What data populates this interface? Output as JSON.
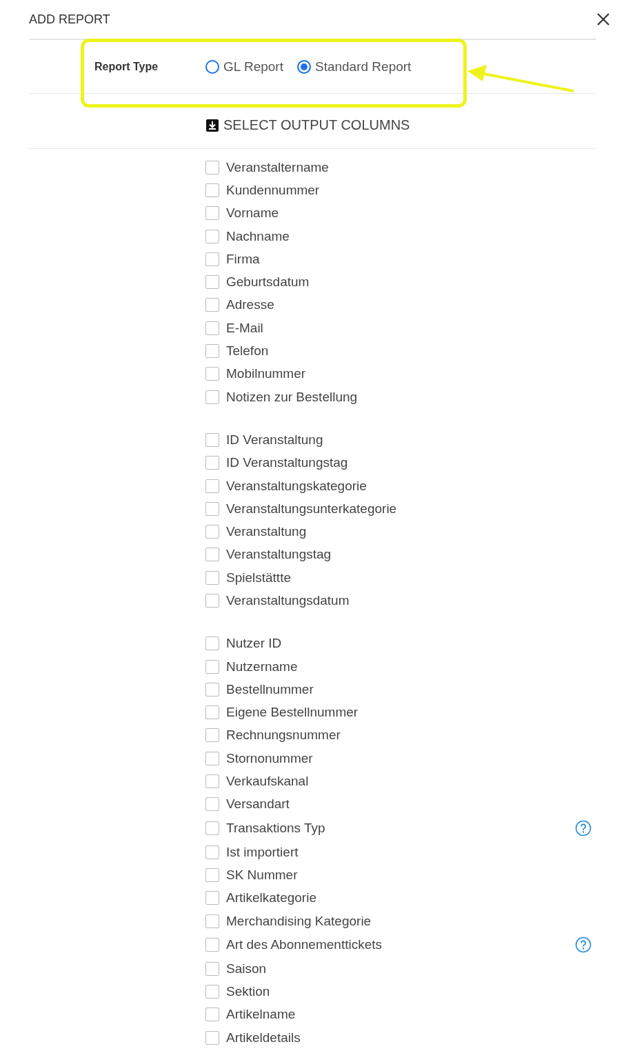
{
  "title": "ADD REPORT",
  "report_type": {
    "label": "Report Type",
    "options": [
      {
        "label": "GL Report",
        "selected": false
      },
      {
        "label": "Standard Report",
        "selected": true
      }
    ]
  },
  "section": {
    "title": "SELECT OUTPUT COLUMNS"
  },
  "groups": [
    {
      "items": [
        {
          "label": "Veranstaltername",
          "checked": false,
          "help": false
        },
        {
          "label": "Kundennummer",
          "checked": false,
          "help": false
        },
        {
          "label": "Vorname",
          "checked": false,
          "help": false
        },
        {
          "label": "Nachname",
          "checked": false,
          "help": false
        },
        {
          "label": "Firma",
          "checked": false,
          "help": false
        },
        {
          "label": "Geburtsdatum",
          "checked": false,
          "help": false
        },
        {
          "label": "Adresse",
          "checked": false,
          "help": false
        },
        {
          "label": "E-Mail",
          "checked": false,
          "help": false
        },
        {
          "label": "Telefon",
          "checked": false,
          "help": false
        },
        {
          "label": "Mobilnummer",
          "checked": false,
          "help": false
        },
        {
          "label": "Notizen zur Bestellung",
          "checked": false,
          "help": false
        }
      ]
    },
    {
      "items": [
        {
          "label": "ID Veranstaltung",
          "checked": false,
          "help": false
        },
        {
          "label": "ID Veranstaltungstag",
          "checked": false,
          "help": false
        },
        {
          "label": "Veranstaltungskategorie",
          "checked": false,
          "help": false
        },
        {
          "label": "Veranstaltungsunterkategorie",
          "checked": false,
          "help": false
        },
        {
          "label": "Veranstaltung",
          "checked": false,
          "help": false
        },
        {
          "label": "Veranstaltungstag",
          "checked": false,
          "help": false
        },
        {
          "label": "Spielstättte",
          "checked": false,
          "help": false
        },
        {
          "label": "Veranstaltungsdatum",
          "checked": false,
          "help": false
        }
      ]
    },
    {
      "items": [
        {
          "label": "Nutzer ID",
          "checked": false,
          "help": false
        },
        {
          "label": "Nutzername",
          "checked": false,
          "help": false
        },
        {
          "label": "Bestellnummer",
          "checked": false,
          "help": false
        },
        {
          "label": "Eigene Bestellnummer",
          "checked": false,
          "help": false
        },
        {
          "label": "Rechnungsnummer",
          "checked": false,
          "help": false
        },
        {
          "label": "Stornonummer",
          "checked": false,
          "help": false
        },
        {
          "label": "Verkaufskanal",
          "checked": false,
          "help": false
        },
        {
          "label": "Versandart",
          "checked": false,
          "help": false
        },
        {
          "label": "Transaktions Typ",
          "checked": false,
          "help": true
        },
        {
          "label": "Ist importiert",
          "checked": false,
          "help": false
        },
        {
          "label": "SK Nummer",
          "checked": false,
          "help": false
        },
        {
          "label": "Artikelkategorie",
          "checked": false,
          "help": false
        },
        {
          "label": "Merchandising Kategorie",
          "checked": false,
          "help": false
        },
        {
          "label": "Art des Abonnementtickets",
          "checked": false,
          "help": true
        },
        {
          "label": "Saison",
          "checked": false,
          "help": false
        },
        {
          "label": "Sektion",
          "checked": false,
          "help": false
        },
        {
          "label": "Artikelname",
          "checked": false,
          "help": false
        },
        {
          "label": "Artikeldetails",
          "checked": false,
          "help": false
        }
      ]
    }
  ]
}
